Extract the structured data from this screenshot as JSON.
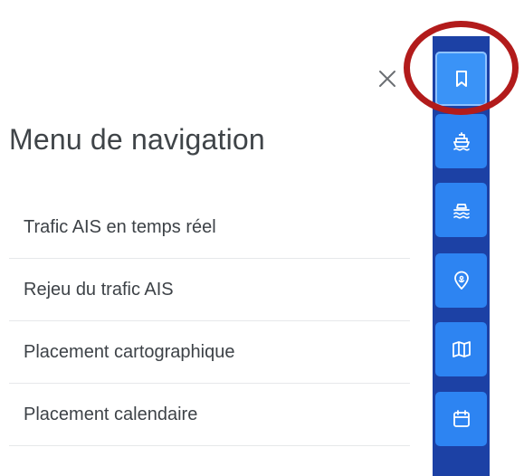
{
  "panel": {
    "title": "Menu de navigation",
    "close_icon": "close-icon"
  },
  "menu": {
    "items": [
      {
        "label": "Trafic AIS en temps réel"
      },
      {
        "label": "Rejeu du trafic AIS"
      },
      {
        "label": "Placement cartographique"
      },
      {
        "label": "Placement calendaire"
      }
    ]
  },
  "sidebar": {
    "buttons": [
      {
        "icon": "bookmark-icon",
        "active": true
      },
      {
        "icon": "ship-icon",
        "active": false
      },
      {
        "icon": "ferry-waves-icon",
        "active": false
      },
      {
        "icon": "location-pin-icon",
        "active": false
      },
      {
        "icon": "map-icon",
        "active": false
      },
      {
        "icon": "calendar-icon",
        "active": false
      }
    ]
  },
  "colors": {
    "sidebar_background": "#1c41a5",
    "button_background": "#2d84f2",
    "highlight_ring": "#b21b1b",
    "text": "#3d4247"
  }
}
